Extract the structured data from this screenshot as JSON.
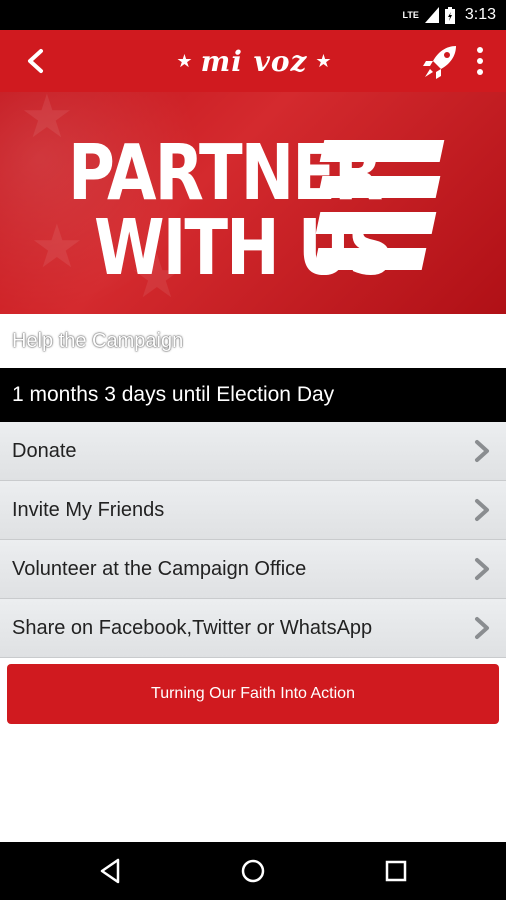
{
  "status_bar": {
    "network": "LTE",
    "time": "3:13"
  },
  "app_bar": {
    "logo_text": "mi voz",
    "logo_star": "★"
  },
  "banner": {
    "line1": "PARTNER",
    "line2": "WITH US"
  },
  "section": {
    "title": "Help the Campaign"
  },
  "countdown": {
    "text": "1 months 3 days until Election Day"
  },
  "menu_items": [
    {
      "label": "Donate"
    },
    {
      "label": "Invite My Friends"
    },
    {
      "label": "Volunteer at the Campaign Office"
    },
    {
      "label": "Share on Facebook,Twitter or WhatsApp"
    }
  ],
  "action_button": {
    "label": "Turning Our Faith Into Action"
  },
  "colors": {
    "brand_red": "#d01a1f",
    "black": "#000000",
    "list_bg": "#e6e8ea"
  }
}
